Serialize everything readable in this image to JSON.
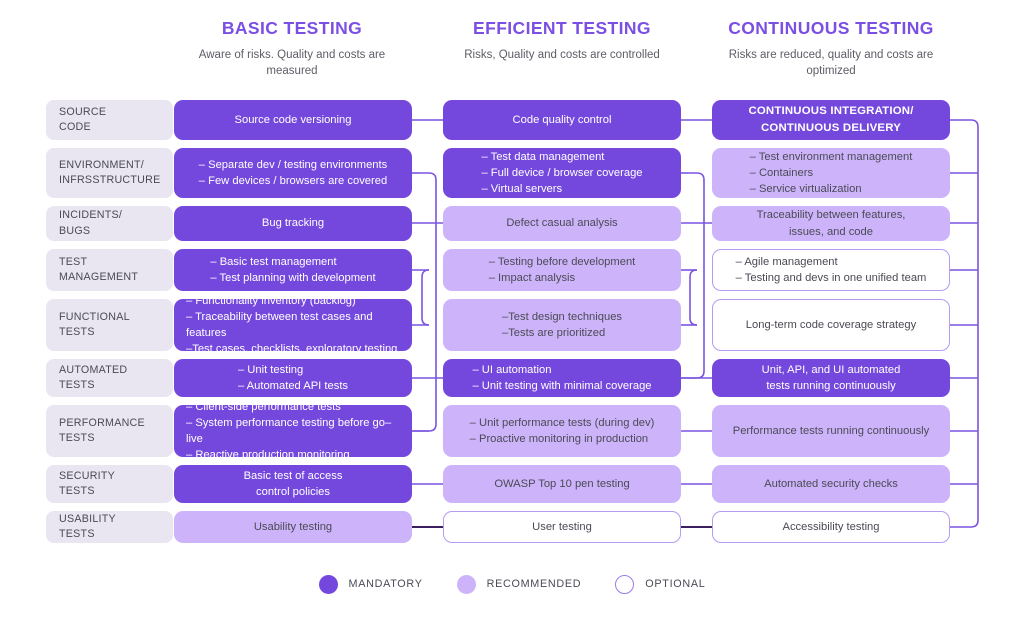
{
  "colors": {
    "mandatory": "#7548dd",
    "recommended": "#cdb4fa",
    "optional_border": "#b69bf0",
    "heading": "#7b4fe3",
    "row_label_bg": "#e9e6f2",
    "text_dark": "#4a4a55",
    "wire": "#7b54e0"
  },
  "columns": [
    {
      "title": "BASIC TESTING",
      "subtitle": "Aware of risks.\nQuality and costs\nare measured"
    },
    {
      "title": "EFFICIENT TESTING",
      "subtitle": "Risks, Quality and\ncosts are controlled"
    },
    {
      "title": "CONTINUOUS TESTING",
      "subtitle": "Risks are reduced, quality\nand costs are optimized"
    }
  ],
  "rows": [
    {
      "label": "SOURCE\nCODE",
      "cells": [
        {
          "text": "Source code versioning",
          "level": "mandatory",
          "multiline": false,
          "bold": false
        },
        {
          "text": "Code quality control",
          "level": "mandatory",
          "multiline": false,
          "bold": false
        },
        {
          "text": "CONTINUOUS INTEGRATION/\nCONTINUOUS DELIVERY",
          "level": "mandatory",
          "multiline": false,
          "bold": true
        }
      ]
    },
    {
      "label": "ENVIRONMENT/\nINFRSSTRUCTURE",
      "cells": [
        {
          "text": "– Separate dev / testing environments\n– Few devices / browsers are covered",
          "level": "mandatory",
          "multiline": true,
          "bold": false
        },
        {
          "text": "– Test data management\n– Full device / browser coverage\n– Virtual servers",
          "level": "mandatory",
          "multiline": true,
          "bold": false
        },
        {
          "text": "– Test environment management\n– Containers\n– Service virtualization",
          "level": "recommended",
          "multiline": true,
          "bold": false
        }
      ]
    },
    {
      "label": "INCIDENTS/\nBUGS",
      "cells": [
        {
          "text": "Bug tracking",
          "level": "mandatory",
          "multiline": false,
          "bold": false
        },
        {
          "text": "Defect casual analysis",
          "level": "recommended",
          "multiline": false,
          "bold": false
        },
        {
          "text": "Traceability between features,\nissues, and code",
          "level": "recommended",
          "multiline": false,
          "bold": false
        }
      ]
    },
    {
      "label": "TEST\nMANAGEMENT",
      "cells": [
        {
          "text": "– Basic test management\n– Test planning with development",
          "level": "mandatory",
          "multiline": true,
          "bold": false
        },
        {
          "text": "– Testing before development\n– Impact analysis",
          "level": "recommended",
          "multiline": true,
          "bold": false
        },
        {
          "text": "– Agile management\n– Testing and devs in one unified team",
          "level": "optional",
          "multiline": true,
          "bold": false
        }
      ]
    },
    {
      "label": "FUNCTIONAL\nTESTS",
      "cells": [
        {
          "text": "– Functionality inventory (backlog)\n– Traceability between test cases and features\n–Test cases, checklists, exploratory testing",
          "level": "mandatory",
          "multiline": true,
          "bold": false
        },
        {
          "text": "–Test design techniques\n–Tests are prioritized",
          "level": "recommended",
          "multiline": true,
          "bold": false
        },
        {
          "text": "Long-term code coverage strategy",
          "level": "optional",
          "multiline": false,
          "bold": false
        }
      ]
    },
    {
      "label": "AUTOMATED\nTESTS",
      "cells": [
        {
          "text": "– Unit testing\n– Automated API tests",
          "level": "mandatory",
          "multiline": true,
          "bold": false
        },
        {
          "text": "– UI automation\n– Unit testing with minimal coverage",
          "level": "mandatory",
          "multiline": true,
          "bold": false
        },
        {
          "text": "Unit, API, and UI automated\ntests running continuously",
          "level": "mandatory",
          "multiline": false,
          "bold": false
        }
      ]
    },
    {
      "label": "PERFORMANCE\nTESTS",
      "cells": [
        {
          "text": "– Client-side performance tests\n– System performance testing before go–live\n– Reactive production monitoring",
          "level": "mandatory",
          "multiline": true,
          "bold": false
        },
        {
          "text": "– Unit performance tests (during dev)\n– Proactive monitoring in production",
          "level": "recommended",
          "multiline": true,
          "bold": false
        },
        {
          "text": "Performance tests running continuously",
          "level": "recommended",
          "multiline": false,
          "bold": false
        }
      ]
    },
    {
      "label": "SECURITY\nTESTS",
      "cells": [
        {
          "text": "Basic test of access\ncontrol policies",
          "level": "mandatory",
          "multiline": false,
          "bold": false
        },
        {
          "text": "OWASP Top 10 pen testing",
          "level": "recommended",
          "multiline": false,
          "bold": false
        },
        {
          "text": "Automated security checks",
          "level": "recommended",
          "multiline": false,
          "bold": false
        }
      ]
    },
    {
      "label": "USABILITY\nTESTS",
      "cells": [
        {
          "text": "Usability testing",
          "level": "recommended",
          "multiline": false,
          "bold": false
        },
        {
          "text": "User testing",
          "level": "optional",
          "multiline": false,
          "bold": false
        },
        {
          "text": "Accessibility testing",
          "level": "optional",
          "multiline": false,
          "bold": false
        }
      ]
    }
  ],
  "legend": [
    {
      "label": "MANDATORY",
      "level": "mandatory"
    },
    {
      "label": "RECOMMENDED",
      "level": "recommended"
    },
    {
      "label": "OPTIONAL",
      "level": "optional"
    }
  ]
}
